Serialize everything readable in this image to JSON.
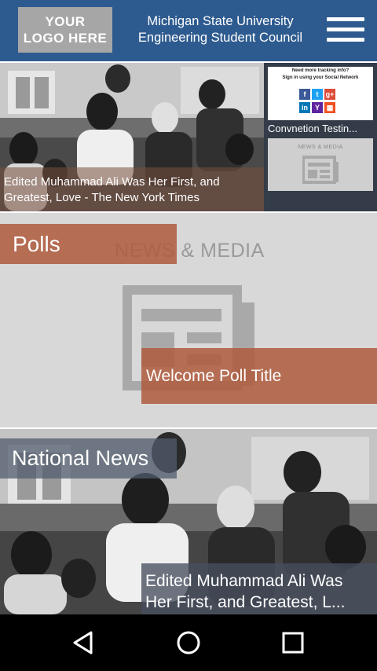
{
  "header": {
    "logo_line1": "YOUR",
    "logo_line2": "LOGO HERE",
    "title_line1": "Michigan State University",
    "title_line2": "Engineering Student Council",
    "menu_icon": "hamburger-menu-icon"
  },
  "featured": {
    "caption_line1": "Edited Muhammad Ali Was Her First, and",
    "caption_line2": "Greatest, Love - The New York Times",
    "thumbs": [
      {
        "banner_line1": "Need more tracking info?",
        "banner_line2": "Sign in using your Social Network",
        "social_icons": [
          "f",
          "t",
          "g+",
          "in",
          "Y",
          "ms"
        ],
        "label": "Convnetion Testin..."
      },
      {
        "media_label": "NEWS & MEDIA",
        "icon": "newspaper-icon"
      }
    ]
  },
  "polls": {
    "label": "Polls",
    "background_text": "NEWS & MEDIA",
    "poll_title": "Welcome Poll Title"
  },
  "national_news": {
    "label": "National News",
    "caption_line1": "Edited Muhammad Ali Was",
    "caption_line2": "Her First, and Greatest, L..."
  },
  "navbar": {
    "buttons": [
      "back",
      "home",
      "recents"
    ]
  },
  "colors": {
    "header_bg": "#2e5b8f",
    "accent_orange": "#af5a3c",
    "slate_overlay": "#505c6c"
  }
}
